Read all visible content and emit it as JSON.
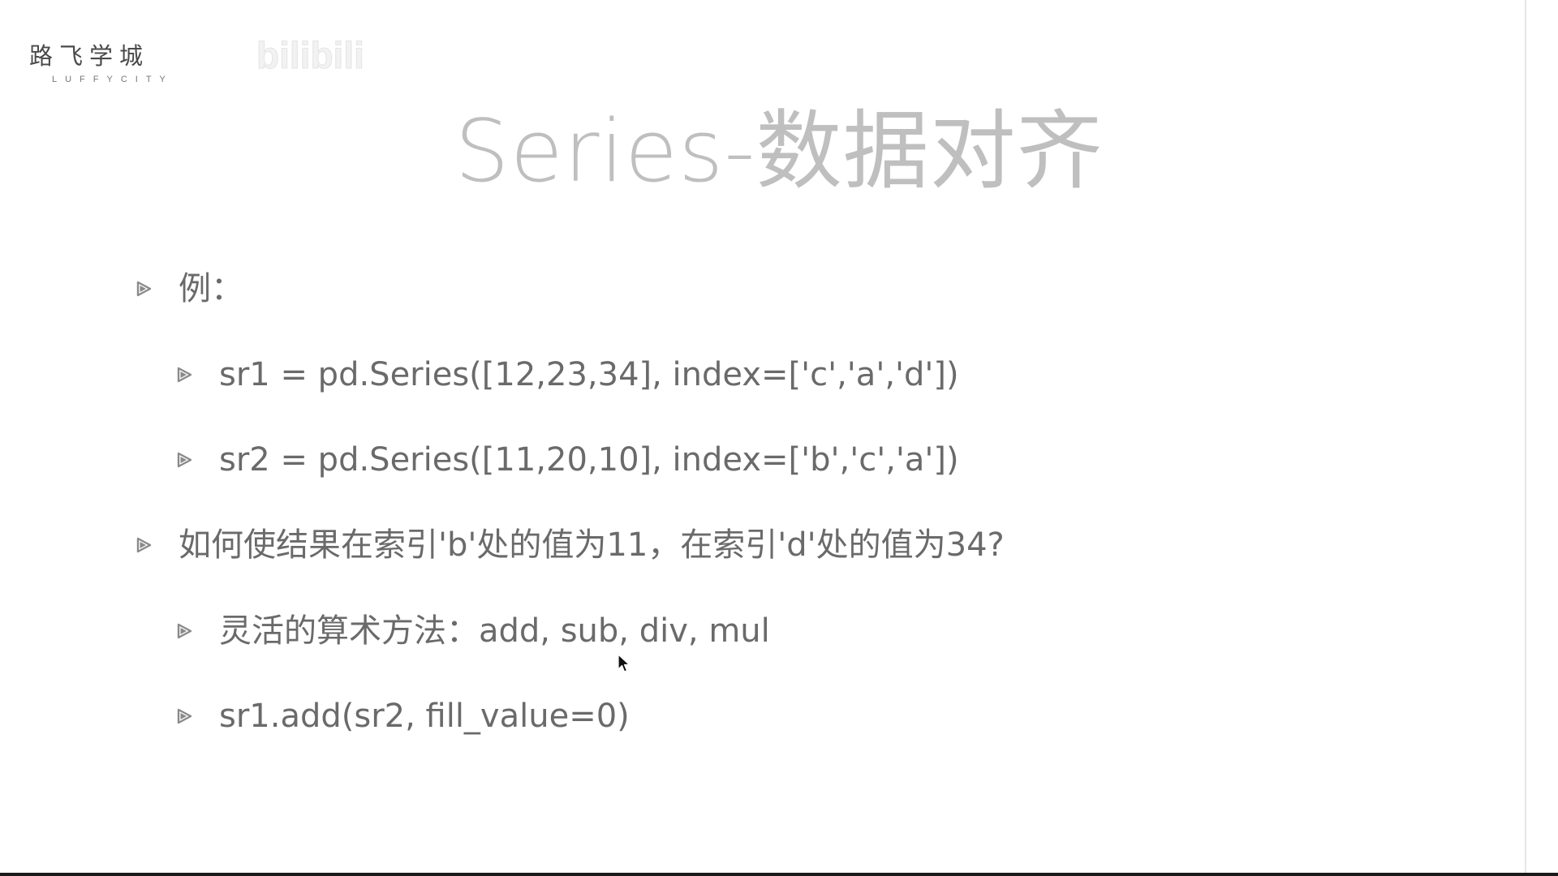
{
  "logo": {
    "name_cn": "路飞学城",
    "name_en": "LUFFYCITY"
  },
  "watermark": {
    "text": "bilibili"
  },
  "slide": {
    "title": "Series-数据对齐",
    "bullets": [
      {
        "level": 1,
        "text": "例："
      },
      {
        "level": 2,
        "text": "sr1 = pd.Series([12,23,34], index=['c','a','d'])"
      },
      {
        "level": 2,
        "text": "sr2 = pd.Series([11,20,10], index=['b','c','a'])"
      },
      {
        "level": 1,
        "text": "如何使结果在索引'b'处的值为11，在索引'd'处的值为34?"
      },
      {
        "level": 2,
        "text": "灵活的算术方法：add, sub, div, mul"
      },
      {
        "level": 2,
        "text": "sr1.add(sr2, fill_value=0)"
      }
    ]
  },
  "icons": {
    "bullet_marker": "triangle-bullet-icon",
    "cursor": "mouse-pointer-icon"
  },
  "colors": {
    "title": "#bfbfbf",
    "body_text": "#6a6a6a",
    "marker": "#8a8a8a",
    "bottom_bar": "#1a1a1a"
  }
}
